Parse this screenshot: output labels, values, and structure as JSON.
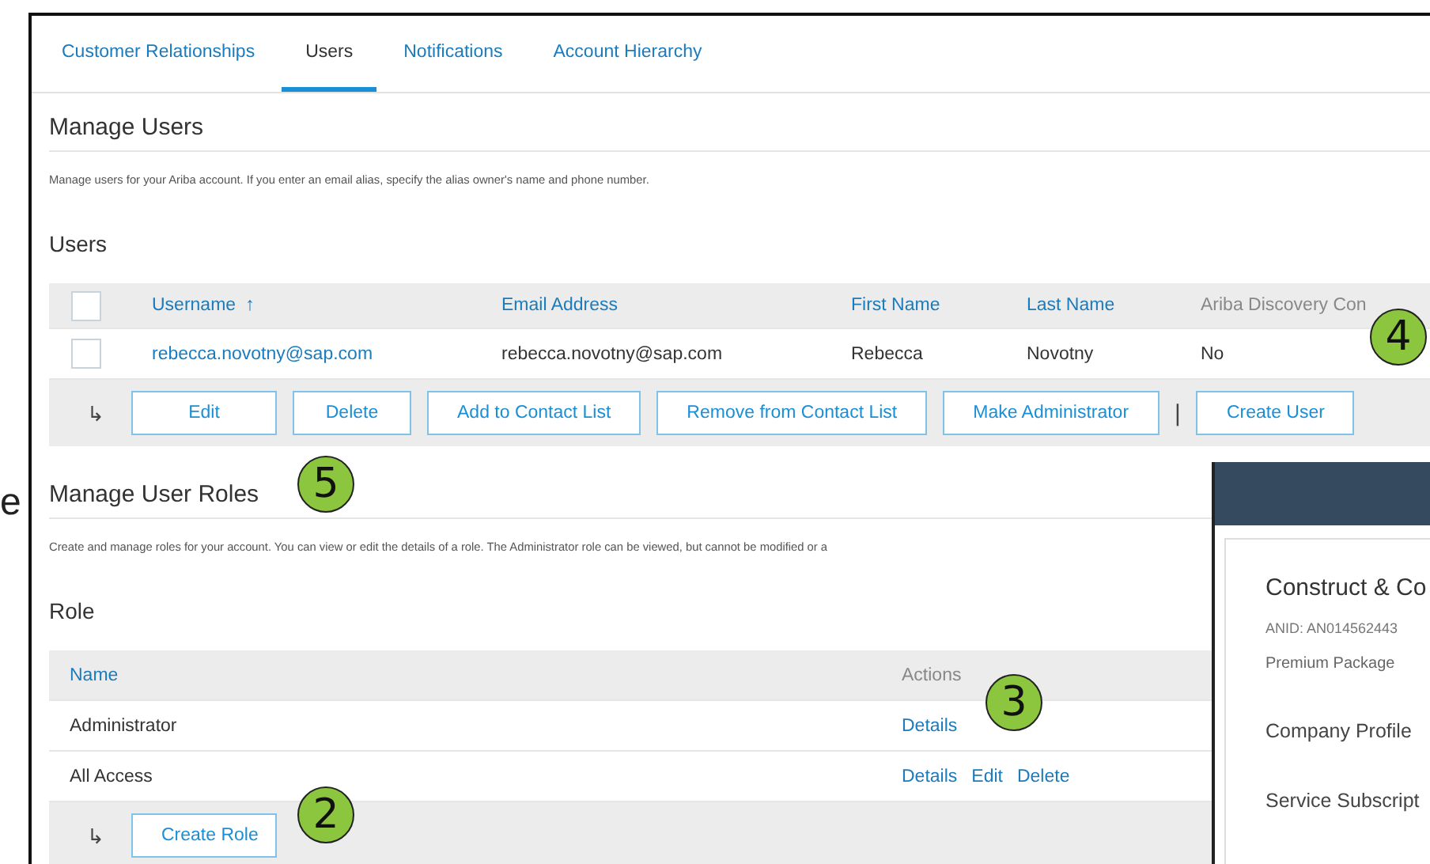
{
  "slide_fragment": "e",
  "tabs": [
    {
      "label": "Customer Relationships",
      "selected": false
    },
    {
      "label": "Users",
      "selected": true
    },
    {
      "label": "Notifications",
      "selected": false
    },
    {
      "label": "Account Hierarchy",
      "selected": false
    }
  ],
  "manage_users": {
    "title": "Manage Users",
    "description": "Manage users for your Ariba account. If you enter an email alias, specify the alias owner's name and phone number."
  },
  "users": {
    "title": "Users",
    "select_all_checked": false,
    "columns": [
      {
        "label": "Username",
        "sortable": true,
        "sort_indicator": "↑"
      },
      {
        "label": "Email Address",
        "sortable": true
      },
      {
        "label": "First Name",
        "sortable": true
      },
      {
        "label": "Last Name",
        "sortable": true
      },
      {
        "label": "Ariba Discovery Con",
        "sortable": false
      }
    ],
    "rows": [
      {
        "checked": false,
        "cells": [
          "rebecca.novotny@sap.com",
          "rebecca.novotny@sap.com",
          "Rebecca",
          "Novotny",
          "No"
        ]
      }
    ],
    "action_arrow": "↳",
    "actions": [
      {
        "kind": "button",
        "label": "Edit"
      },
      {
        "kind": "button",
        "label": "Delete"
      },
      {
        "kind": "button",
        "label": "Add to Contact List"
      },
      {
        "kind": "button",
        "label": "Remove from Contact List"
      },
      {
        "kind": "button",
        "label": "Make Administrator"
      },
      {
        "kind": "separator",
        "label": "|"
      },
      {
        "kind": "button",
        "label": "Create User"
      }
    ]
  },
  "manage_roles": {
    "title": "Manage User Roles",
    "description": "Create and manage roles for your account. You can view or edit the details of a role. The Administrator role can be viewed, but cannot be modified or a"
  },
  "roles": {
    "title": "Role",
    "columns": [
      "Name",
      "Actions"
    ],
    "rows": [
      {
        "name": "Administrator",
        "actions": [
          "Details"
        ]
      },
      {
        "name": "All Access",
        "actions": [
          "Details",
          "Edit",
          "Delete"
        ]
      }
    ],
    "action_arrow": "↳",
    "create_button": "Create Role"
  },
  "company_panel": {
    "company": "Construct & Co",
    "anid": "ANID: AN014562443",
    "package": "Premium Package",
    "menu": [
      "Company Profile",
      "Service Subscript"
    ]
  },
  "callouts": [
    "4",
    "5",
    "3",
    "2"
  ]
}
